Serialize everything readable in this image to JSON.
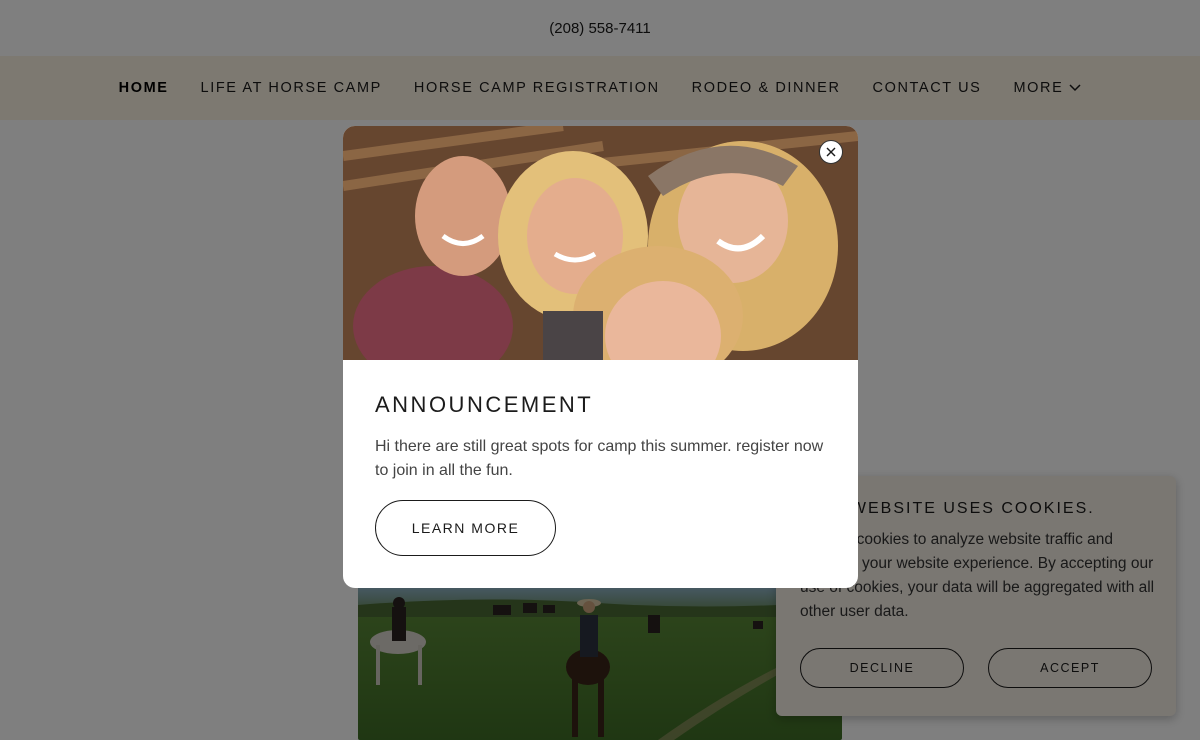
{
  "header": {
    "phone": "(208) 558-7411"
  },
  "nav": {
    "items": [
      {
        "label": "HOME",
        "active": true
      },
      {
        "label": "LIFE AT HORSE CAMP",
        "active": false
      },
      {
        "label": "HORSE CAMP REGISTRATION",
        "active": false
      },
      {
        "label": "RODEO & DINNER",
        "active": false
      },
      {
        "label": "CONTACT US",
        "active": false
      }
    ],
    "more_label": "MORE"
  },
  "cookie_banner": {
    "title": "THIS WEBSITE USES COOKIES.",
    "text": "We use cookies to analyze website traffic and optimize your website experience. By accepting our use of cookies, your data will be aggregated with all other user data.",
    "decline_label": "DECLINE",
    "accept_label": "ACCEPT"
  },
  "modal": {
    "title": "ANNOUNCEMENT",
    "text": "Hi there are still great spots for camp this summer. register now to join in all the fun.",
    "button_label": "LEARN MORE",
    "image": "group-selfie-photo",
    "close_icon": "close-icon"
  },
  "background_image": "horseback-riders-meadow-photo",
  "colors": {
    "nav_background": "#fbf2e3",
    "cookie_background": "#f4eee5",
    "overlay": "rgba(0,0,0,0.5)",
    "text": "#1b1b1b"
  }
}
